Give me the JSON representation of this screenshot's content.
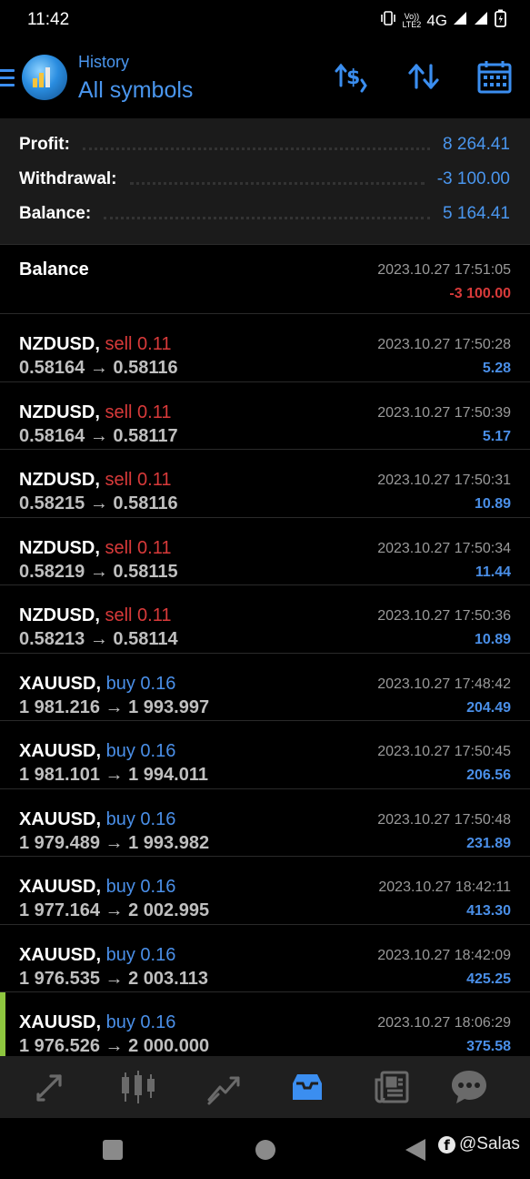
{
  "status_bar": {
    "time": "11:42",
    "network": "4G",
    "volte_line1": "Vo))",
    "volte_line2": "LTE2"
  },
  "header": {
    "subtitle": "History",
    "title": "All symbols",
    "accent_color": "#3b8ef0"
  },
  "summary": {
    "profit_label": "Profit:",
    "profit_value": "8 264.41",
    "withdrawal_label": "Withdrawal:",
    "withdrawal_value": "-3 100.00",
    "balance_label": "Balance:",
    "balance_value": "5 164.41"
  },
  "balance_entry": {
    "label": "Balance",
    "time": "2023.10.27 17:51:05",
    "amount": "-3 100.00"
  },
  "trades": [
    {
      "symbol": "NZDUSD,",
      "side": "sell",
      "volume": "0.11",
      "prices": "0.58164 → 0.58116",
      "time": "2023.10.27 17:50:28",
      "profit": "5.28"
    },
    {
      "symbol": "NZDUSD,",
      "side": "sell",
      "volume": "0.11",
      "prices": "0.58164 → 0.58117",
      "time": "2023.10.27 17:50:39",
      "profit": "5.17"
    },
    {
      "symbol": "NZDUSD,",
      "side": "sell",
      "volume": "0.11",
      "prices": "0.58215 → 0.58116",
      "time": "2023.10.27 17:50:31",
      "profit": "10.89"
    },
    {
      "symbol": "NZDUSD,",
      "side": "sell",
      "volume": "0.11",
      "prices": "0.58219 → 0.58115",
      "time": "2023.10.27 17:50:34",
      "profit": "11.44"
    },
    {
      "symbol": "NZDUSD,",
      "side": "sell",
      "volume": "0.11",
      "prices": "0.58213 → 0.58114",
      "time": "2023.10.27 17:50:36",
      "profit": "10.89"
    },
    {
      "symbol": "XAUUSD,",
      "side": "buy",
      "volume": "0.16",
      "prices": "1 981.216 → 1 993.997",
      "time": "2023.10.27 17:48:42",
      "profit": "204.49"
    },
    {
      "symbol": "XAUUSD,",
      "side": "buy",
      "volume": "0.16",
      "prices": "1 981.101 → 1 994.011",
      "time": "2023.10.27 17:50:45",
      "profit": "206.56"
    },
    {
      "symbol": "XAUUSD,",
      "side": "buy",
      "volume": "0.16",
      "prices": "1 979.489 → 1 993.982",
      "time": "2023.10.27 17:50:48",
      "profit": "231.89"
    },
    {
      "symbol": "XAUUSD,",
      "side": "buy",
      "volume": "0.16",
      "prices": "1 977.164 → 2 002.995",
      "time": "2023.10.27 18:42:11",
      "profit": "413.30"
    },
    {
      "symbol": "XAUUSD,",
      "side": "buy",
      "volume": "0.16",
      "prices": "1 976.535 → 2 003.113",
      "time": "2023.10.27 18:42:09",
      "profit": "425.25"
    },
    {
      "symbol": "XAUUSD,",
      "side": "buy",
      "volume": "0.16",
      "prices": "1 976.526 → 2 000.000",
      "time": "2023.10.27 18:06:29",
      "profit": "375.58"
    }
  ],
  "colors": {
    "positive": "#4a8fe8",
    "negative": "#d83a3a",
    "selected_indicator": "#8ec63f"
  },
  "bottom_nav": {
    "items": [
      "trade-icon",
      "quotes-icon",
      "chart-icon",
      "history-icon",
      "news-icon",
      "chat-icon"
    ],
    "active": "history-icon"
  },
  "watermark": {
    "text": "@Salas"
  }
}
